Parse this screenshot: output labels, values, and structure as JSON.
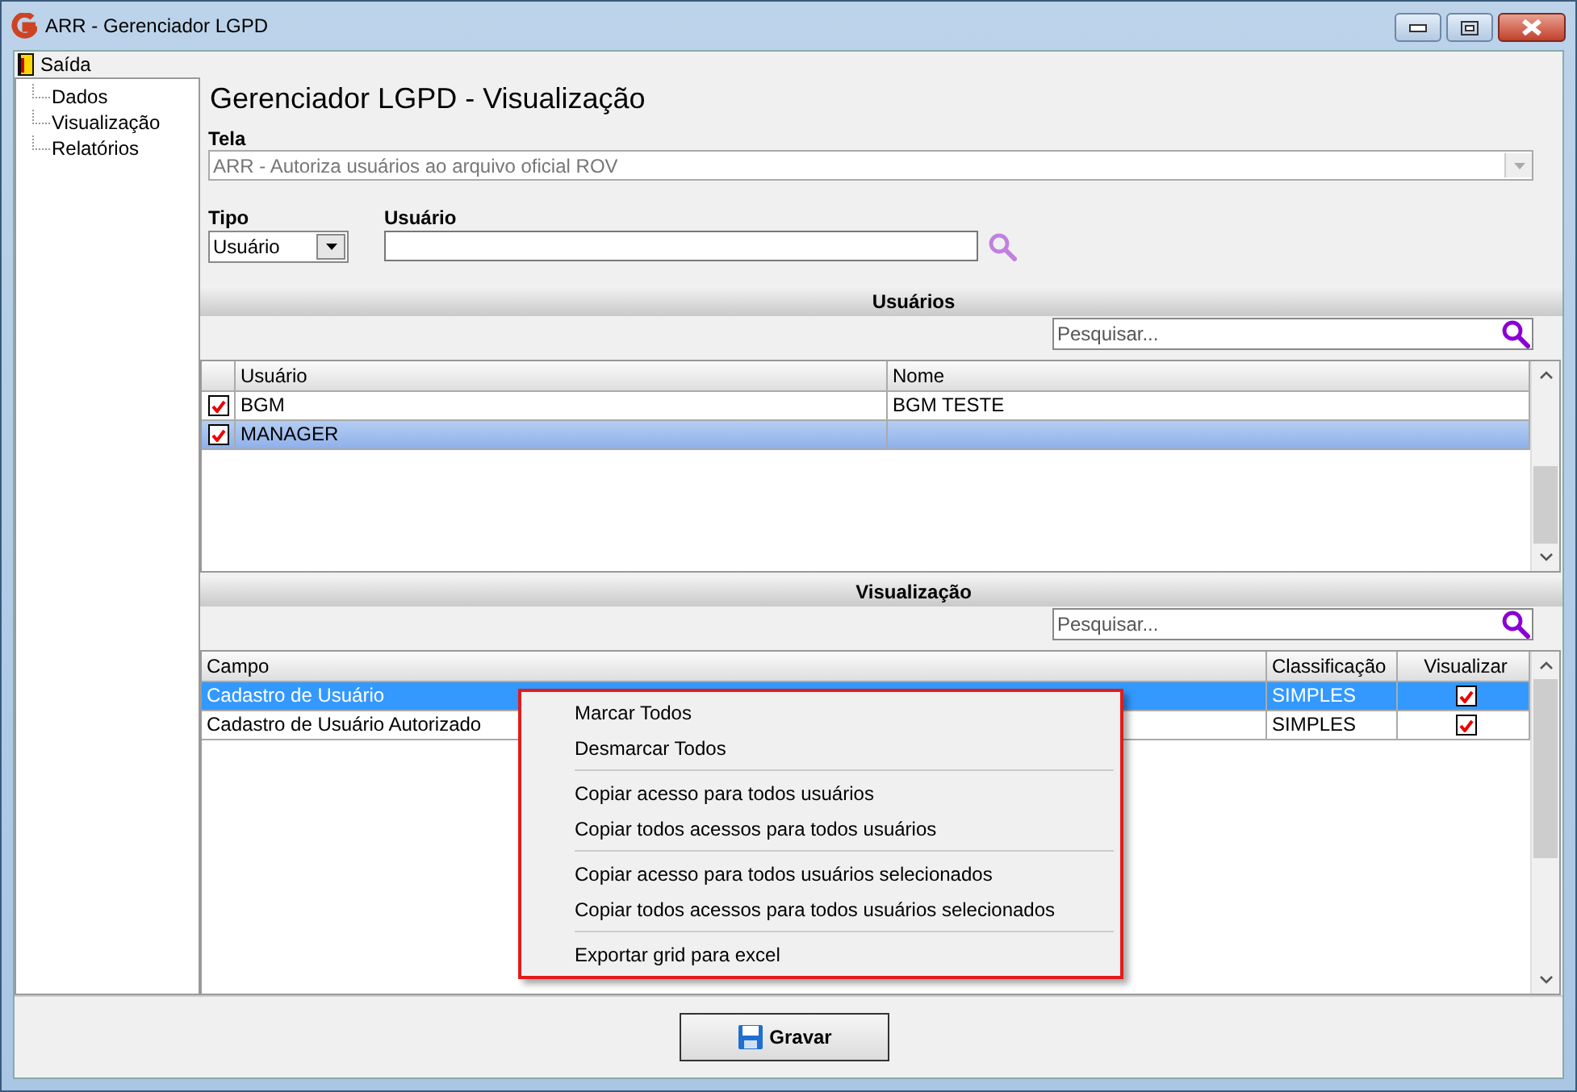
{
  "window": {
    "title": "ARR - Gerenciador LGPD"
  },
  "menu": [
    {
      "label": "Saída"
    }
  ],
  "sidebar": {
    "items": [
      {
        "label": "Dados",
        "selected": false
      },
      {
        "label": "Visualização",
        "selected": false
      },
      {
        "label": "Relatórios",
        "selected": false
      }
    ]
  },
  "page_title": "Gerenciador LGPD - Visualização",
  "tela": {
    "label": "Tela",
    "value": "ARR - Autoriza usuários ao arquivo oficial ROV",
    "disabled": true
  },
  "tipo": {
    "label": "Tipo",
    "value": "Usuário"
  },
  "usuario": {
    "label": "Usuário"
  },
  "users_section": {
    "title": "Usuários",
    "search": {
      "placeholder": "Pesquisar..."
    },
    "columns": [
      "Usuário",
      "Nome"
    ],
    "rows": [
      {
        "checked": true,
        "selected": false,
        "cells": [
          "BGM",
          "BGM TESTE"
        ]
      },
      {
        "checked": true,
        "selected": true,
        "cells": [
          "MANAGER",
          ""
        ]
      }
    ]
  },
  "view_section": {
    "title": "Visualização",
    "search": {
      "placeholder": "Pesquisar..."
    },
    "columns": [
      "Campo",
      "Classificação",
      "Visualizar"
    ],
    "rows": [
      {
        "selected": true,
        "campo": "Cadastro de Usuário",
        "classificacao": "SIMPLES",
        "visualizar": true
      },
      {
        "selected": false,
        "campo": "Cadastro de Usuário Autorizado",
        "classificacao": "SIMPLES",
        "visualizar": true
      }
    ]
  },
  "context_menu": {
    "groups": [
      [
        "Marcar Todos",
        "Desmarcar Todos"
      ],
      [
        "Copiar acesso para todos usuários",
        "Copiar todos acessos para todos usuários"
      ],
      [
        "Copiar acesso para todos usuários selecionados",
        "Copiar todos acessos para todos usuários selecionados"
      ],
      [
        "Exportar grid para excel"
      ]
    ]
  },
  "save_button": {
    "label": "Gravar"
  }
}
